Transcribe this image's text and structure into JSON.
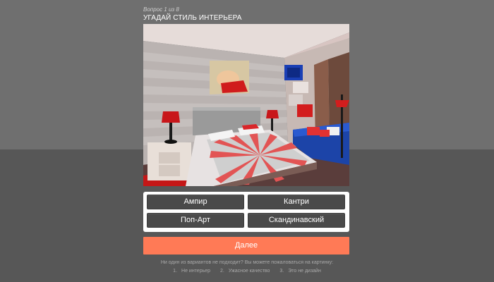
{
  "quiz": {
    "counter": "Вопрос 1 из 8",
    "title": "УГАДАЙ СТИЛЬ ИНТЕРЬЕРА"
  },
  "answers": [
    {
      "label": "Ампир"
    },
    {
      "label": "Кантри"
    },
    {
      "label": "Поп-Арт"
    },
    {
      "label": "Скандинавский"
    }
  ],
  "next_label": "Далее",
  "report": {
    "text": "Ни один из вариантов не подходит? Вы можете пожаловаться на картинку:",
    "options": [
      {
        "num": "1.",
        "label": "Не интерьер"
      },
      {
        "num": "2.",
        "label": "Ужасное качество"
      },
      {
        "num": "3.",
        "label": "Это не дизайн"
      }
    ]
  },
  "colors": {
    "accent": "#ff7a56",
    "button_dark": "#4a4a4a",
    "bg_top": "#6f6f6f",
    "bg_bottom": "#575757"
  }
}
